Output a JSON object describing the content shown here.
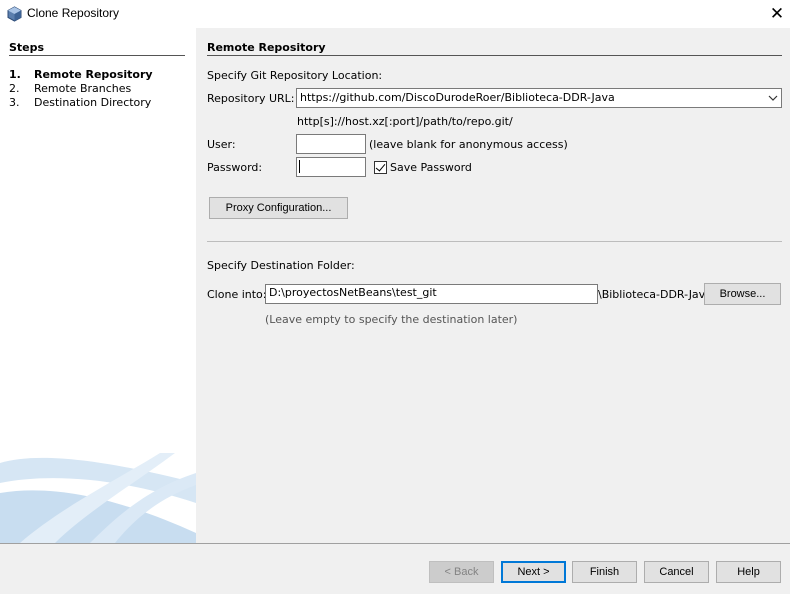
{
  "window": {
    "title": "Clone Repository",
    "close_glyph": "✕",
    "icon": "netbeans-cube-icon"
  },
  "steps": {
    "header": "Steps",
    "items": [
      {
        "num": "1.",
        "label": "Remote Repository",
        "active": true
      },
      {
        "num": "2.",
        "label": "Remote Branches",
        "active": false
      },
      {
        "num": "3.",
        "label": "Destination Directory",
        "active": false
      }
    ]
  },
  "panel": {
    "title": "Remote Repository",
    "location_label": "Specify Git Repository Location:",
    "repo_url_label": "Repository URL:",
    "repo_url_value": "https://github.com/DiscoDurodeRoer/Biblioteca-DDR-Java",
    "url_format_hint": "http[s]://host.xz[:port]/path/to/repo.git/",
    "user_label": "User:",
    "user_value": "",
    "user_hint": "(leave blank for anonymous access)",
    "password_label": "Password:",
    "password_value": "",
    "save_password_label": "Save Password",
    "save_password_checked": true,
    "proxy_button": "Proxy Configuration...",
    "destination_label": "Specify Destination Folder:",
    "clone_into_label": "Clone into:",
    "clone_into_value": "D:\\proyectosNetBeans\\test_git",
    "clone_suffix": "\\Biblioteca-DDR-Java",
    "browse_button": "Browse...",
    "destination_hint": "(Leave empty to specify the destination later)"
  },
  "footer": {
    "back": "< Back",
    "next": "Next >",
    "finish": "Finish",
    "cancel": "Cancel",
    "help": "Help"
  }
}
